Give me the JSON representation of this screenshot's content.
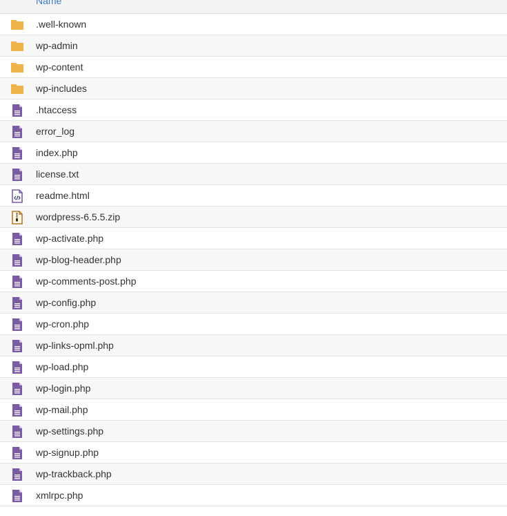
{
  "table": {
    "header": {
      "name_label": "Name"
    },
    "rows": [
      {
        "name": ".well-known",
        "icon": "folder-icon"
      },
      {
        "name": "wp-admin",
        "icon": "folder-icon"
      },
      {
        "name": "wp-content",
        "icon": "folder-icon"
      },
      {
        "name": "wp-includes",
        "icon": "folder-icon"
      },
      {
        "name": ".htaccess",
        "icon": "text-file-icon"
      },
      {
        "name": "error_log",
        "icon": "text-file-icon"
      },
      {
        "name": "index.php",
        "icon": "text-file-icon"
      },
      {
        "name": "license.txt",
        "icon": "text-file-icon"
      },
      {
        "name": "readme.html",
        "icon": "code-file-icon"
      },
      {
        "name": "wordpress-6.5.5.zip",
        "icon": "zip-file-icon"
      },
      {
        "name": "wp-activate.php",
        "icon": "text-file-icon"
      },
      {
        "name": "wp-blog-header.php",
        "icon": "text-file-icon"
      },
      {
        "name": "wp-comments-post.php",
        "icon": "text-file-icon"
      },
      {
        "name": "wp-config.php",
        "icon": "text-file-icon"
      },
      {
        "name": "wp-cron.php",
        "icon": "text-file-icon"
      },
      {
        "name": "wp-links-opml.php",
        "icon": "text-file-icon"
      },
      {
        "name": "wp-load.php",
        "icon": "text-file-icon"
      },
      {
        "name": "wp-login.php",
        "icon": "text-file-icon"
      },
      {
        "name": "wp-mail.php",
        "icon": "text-file-icon"
      },
      {
        "name": "wp-settings.php",
        "icon": "text-file-icon"
      },
      {
        "name": "wp-signup.php",
        "icon": "text-file-icon"
      },
      {
        "name": "wp-trackback.php",
        "icon": "text-file-icon"
      },
      {
        "name": "xmlrpc.php",
        "icon": "text-file-icon"
      }
    ]
  },
  "colors": {
    "folder": "#f0b24a",
    "file": "#7b5ca2",
    "zip": "#b07a2f",
    "header_link": "#3f7ac2"
  }
}
